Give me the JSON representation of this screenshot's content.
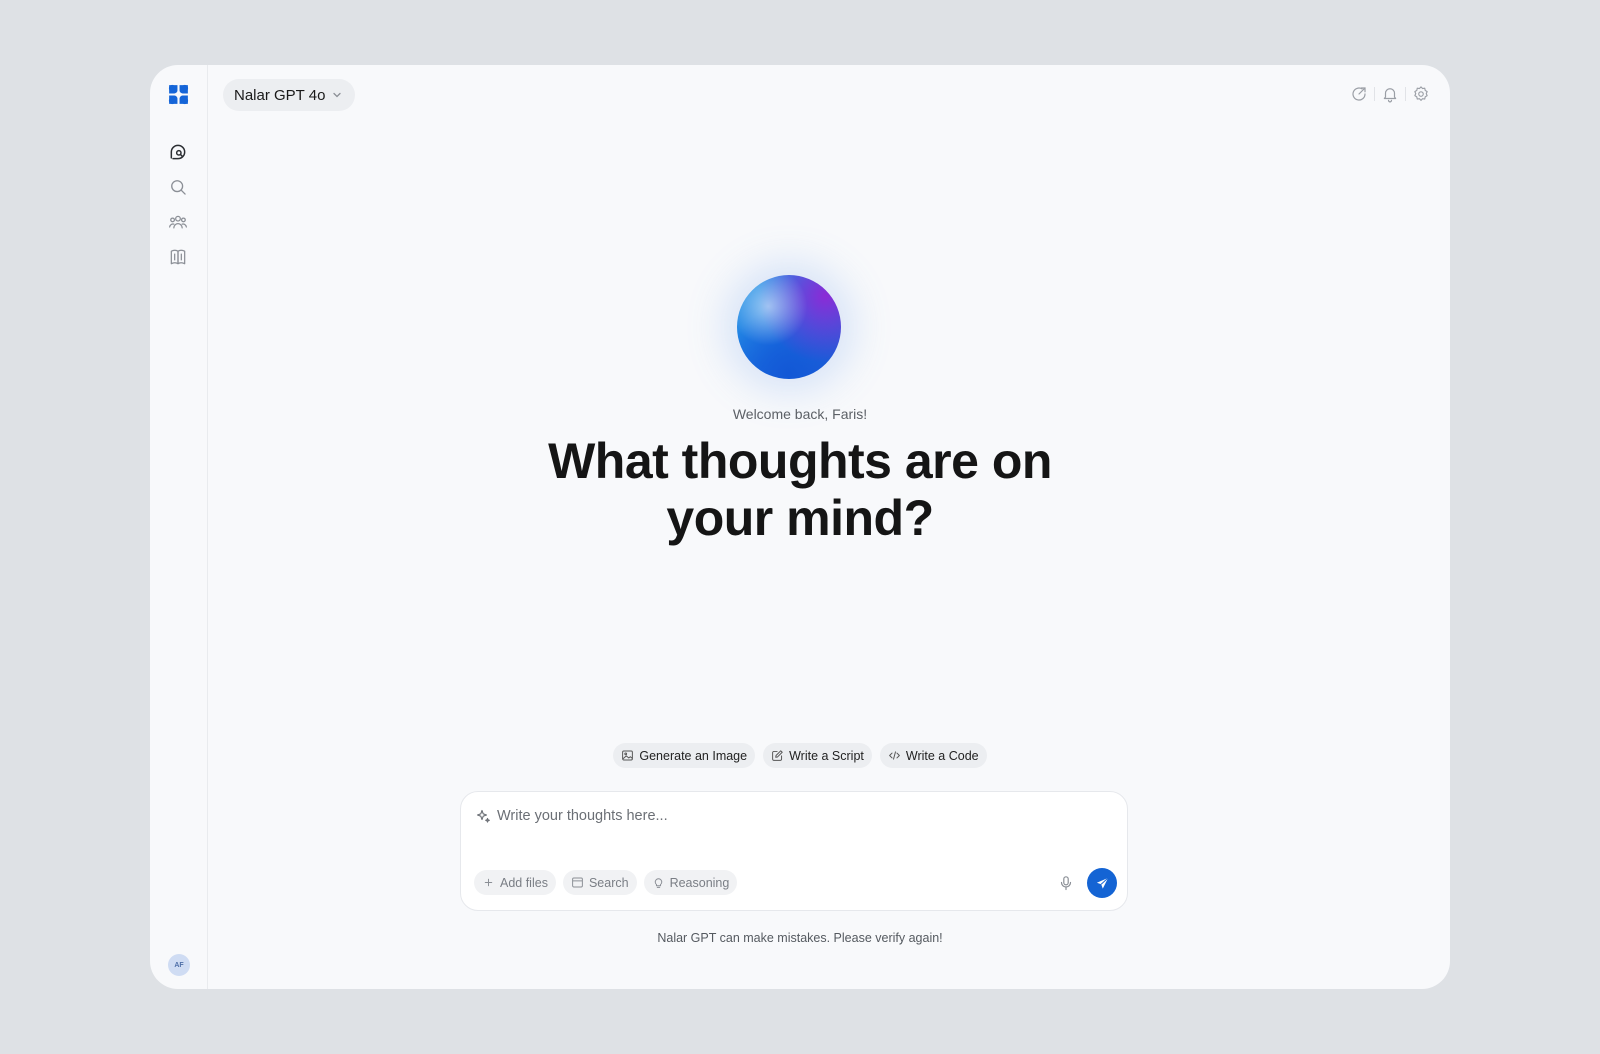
{
  "app": {
    "model_selector": {
      "label": "Nalar GPT 4o",
      "icon": "chevron-down-icon"
    },
    "user": {
      "initials": "AF"
    }
  },
  "sidebar": {
    "items": [
      {
        "name": "new-chat",
        "icon": "chat-bubble-icon"
      },
      {
        "name": "search",
        "icon": "search-icon"
      },
      {
        "name": "community",
        "icon": "users-icon"
      },
      {
        "name": "library",
        "icon": "book-icon"
      }
    ]
  },
  "header": {
    "icons": [
      "share-icon",
      "bell-icon",
      "gear-icon"
    ]
  },
  "hero": {
    "welcome": "Welcome back, Faris!",
    "headline_line1": "What thoughts are on",
    "headline_line2": "your mind?"
  },
  "suggestions": [
    {
      "label": "Generate an Image",
      "icon": "image-icon"
    },
    {
      "label": "Write a Script",
      "icon": "pencil-icon"
    },
    {
      "label": "Write a Code",
      "icon": "code-icon"
    }
  ],
  "composer": {
    "placeholder": "Write your thoughts here...",
    "value": "",
    "tools": [
      {
        "label": "Add files",
        "icon": "plus-icon"
      },
      {
        "label": "Search",
        "icon": "browser-icon"
      },
      {
        "label": "Reasoning",
        "icon": "lightbulb-icon"
      }
    ]
  },
  "footer": {
    "disclaimer": "Nalar GPT can make mistakes. Please verify again!"
  },
  "colors": {
    "accent": "#1464d4",
    "background": "#dee1e5",
    "panel": "#f8f9fb"
  }
}
